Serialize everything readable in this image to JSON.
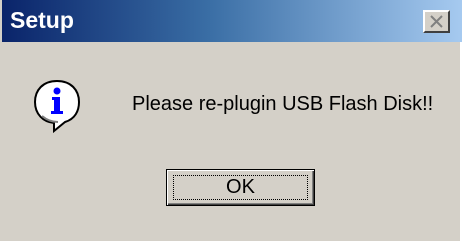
{
  "window": {
    "title": "Setup",
    "close_icon": "close-icon"
  },
  "dialog": {
    "icon": "information-icon",
    "message": "Please re-plugin USB Flash Disk!!",
    "ok_label": "OK"
  },
  "colors": {
    "title_bar_start": "#0a246a",
    "title_bar_end": "#a6caf0",
    "dialog_background": "#d4d0c8",
    "info_icon_blue": "#0000ff"
  }
}
